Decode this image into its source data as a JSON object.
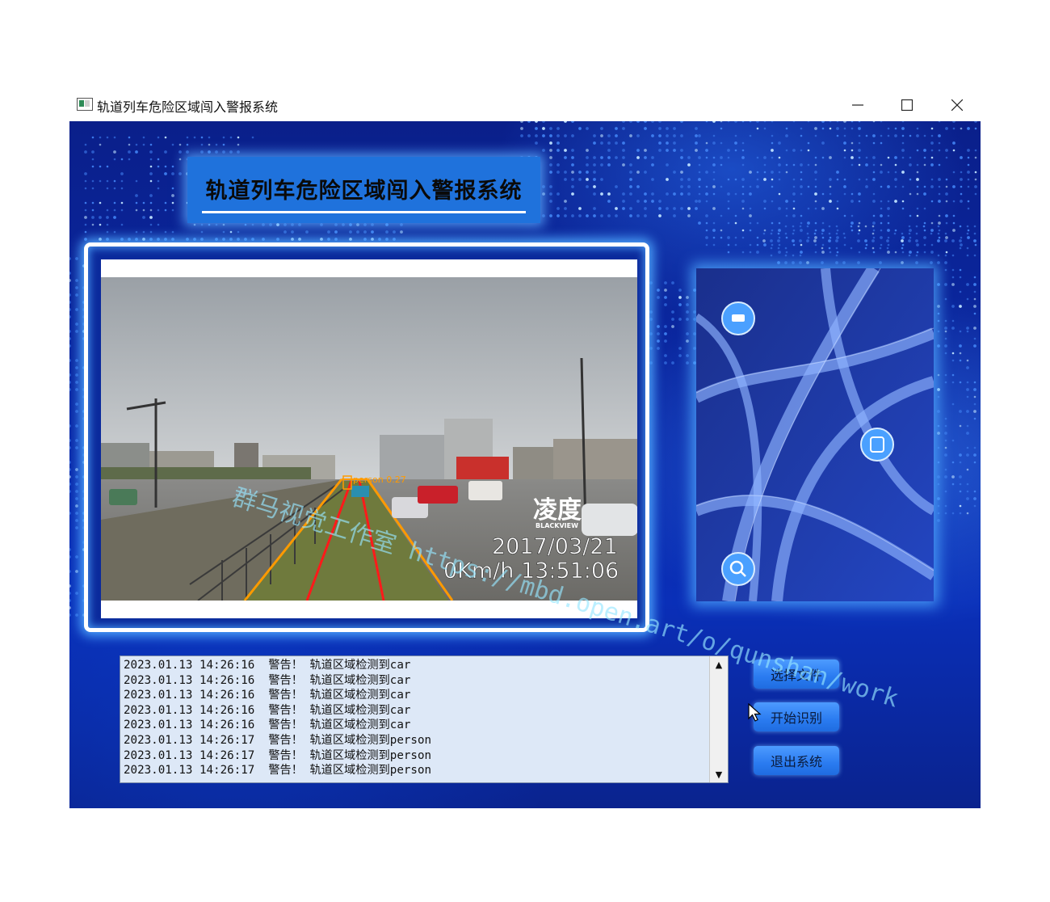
{
  "window": {
    "title": "轨道列车危险区域闯入警报系统",
    "icons": [
      "app-icon",
      "minimize-icon",
      "maximize-icon",
      "close-icon"
    ]
  },
  "header": {
    "title": "轨道列车危险区域闯入警报系统"
  },
  "video": {
    "detection_label": "person 0.27",
    "brand": "凌度",
    "brand_sub": "BLACKVIEW",
    "date": "2017/03/21",
    "speed_time": "0Km/h 13:51:06"
  },
  "log": {
    "lines": [
      "2023.01.13 14:26:16  警告！ 轨道区域检测到car",
      "2023.01.13 14:26:16  警告！ 轨道区域检测到car",
      "2023.01.13 14:26:16  警告！ 轨道区域检测到car",
      "2023.01.13 14:26:16  警告！ 轨道区域检测到car",
      "2023.01.13 14:26:16  警告！ 轨道区域检测到car",
      "2023.01.13 14:26:17  警告！ 轨道区域检测到person",
      "2023.01.13 14:26:17  警告！ 轨道区域检测到person",
      "2023.01.13 14:26:17  警告！ 轨道区域检测到person"
    ]
  },
  "buttons": {
    "select_file": "选择文件",
    "start_recognition": "开始识别",
    "exit_system": "退出系统"
  },
  "watermark": "群马视觉工作室 https://mbd.open.art/o/qunshan/work",
  "colors": {
    "accent": "#2a7bf0",
    "background": "#0b2aa8",
    "alert_line": "#ff1a1a",
    "zone_line": "#ff9a00"
  }
}
